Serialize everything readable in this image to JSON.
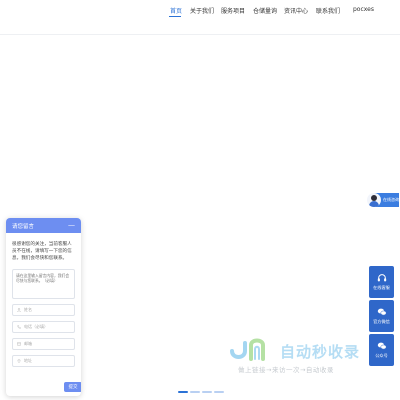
{
  "nav": {
    "items": [
      {
        "label": "首页",
        "active": true
      },
      {
        "label": "关于我们",
        "active": false
      },
      {
        "label": "服务项目",
        "active": false
      },
      {
        "label": "仓储量询",
        "active": false
      },
      {
        "label": "资讯中心",
        "active": false
      },
      {
        "label": "联系我们",
        "active": false
      }
    ],
    "lang": "pocxes"
  },
  "chat": {
    "header_title": "请您留言",
    "minimize_symbol": "—",
    "message": "很感谢您的关注，当前客服人员不在线，请填写一下您的信息，我们会尽快和您联系。",
    "textarea_placeholder": "请在这里输入留言内容，我们会尽快与您联系。（必填）",
    "fields": [
      {
        "placeholder": "姓名",
        "icon": "user-icon"
      },
      {
        "placeholder": "电话（必填）",
        "icon": "phone-icon"
      },
      {
        "placeholder": "邮箱",
        "icon": "mail-icon"
      },
      {
        "placeholder": "地址",
        "icon": "location-icon"
      }
    ],
    "submit_label": "提交"
  },
  "consult": {
    "label": "在线咨询"
  },
  "sidebar": {
    "items": [
      {
        "label": "在线客服",
        "icon": "headset-icon"
      },
      {
        "label": "官方微信",
        "icon": "wechat-icon"
      },
      {
        "label": "公众号",
        "icon": "wechat-icon"
      }
    ]
  },
  "watermark": {
    "title": "自动秒收录",
    "subtitle": "做上链接→来访一次→自动收录"
  },
  "colors": {
    "accent": "#2b72d6",
    "chat_header": "#6d8ef1",
    "sidebar": "#2f67c9"
  },
  "slider": {
    "slide_count": 4,
    "active_slide": 1
  }
}
